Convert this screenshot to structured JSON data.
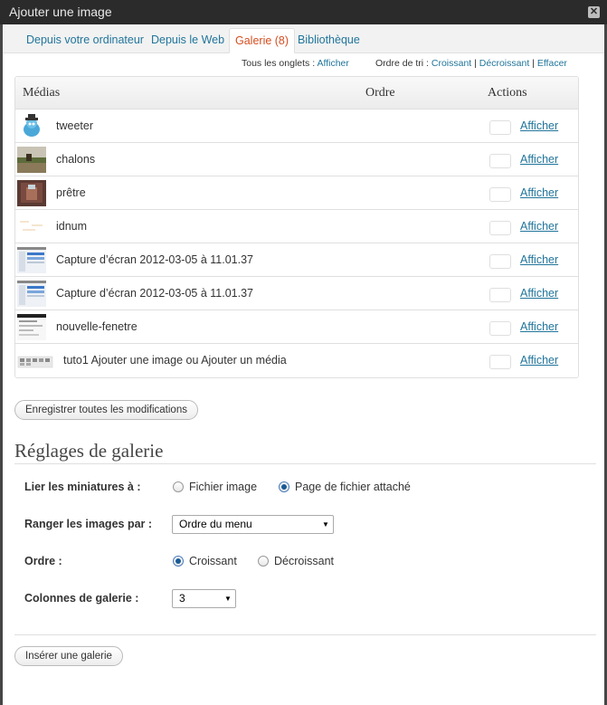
{
  "window": {
    "title": "Ajouter une image",
    "close_glyph": "✕"
  },
  "tabs": [
    {
      "label": "Depuis votre ordinateur",
      "active": false
    },
    {
      "label": "Depuis le Web",
      "active": false
    },
    {
      "label": "Galerie (8)",
      "active": true
    },
    {
      "label": "Bibliothèque",
      "active": false
    }
  ],
  "sort_bar": {
    "all_tabs_label": "Tous les onglets :",
    "all_tabs_link": "Afficher",
    "sort_label": "Ordre de tri :",
    "ascending": "Croissant",
    "separator": "|",
    "descending": "Décroissant",
    "clear": "Effacer"
  },
  "table": {
    "headers": {
      "media": "Médias",
      "order": "Ordre",
      "actions": "Actions"
    },
    "rows": [
      {
        "title": "tweeter",
        "action": "Afficher",
        "thumb": "bird-icon"
      },
      {
        "title": "chalons",
        "action": "Afficher",
        "thumb": "landscape-photo"
      },
      {
        "title": "prêtre",
        "action": "Afficher",
        "thumb": "portrait-photo"
      },
      {
        "title": "idnum",
        "action": "Afficher",
        "thumb": "light-graphic"
      },
      {
        "title": "Capture d’écran 2012-03-05 à 11.01.37",
        "action": "Afficher",
        "thumb": "screenshot"
      },
      {
        "title": "Capture d’écran 2012-03-05 à 11.01.37",
        "action": "Afficher",
        "thumb": "screenshot"
      },
      {
        "title": "nouvelle-fenetre",
        "action": "Afficher",
        "thumb": "window-screenshot"
      },
      {
        "title": "tuto1 Ajouter une image ou Ajouter un média",
        "action": "Afficher",
        "thumb": "toolbar-screenshot"
      }
    ]
  },
  "save_all_label": "Enregistrer toutes les modifications",
  "gallery_settings": {
    "title": "Réglages de galerie",
    "link_thumbs": {
      "label": "Lier les miniatures à :",
      "options": [
        "Fichier image",
        "Page de fichier attaché"
      ],
      "selected": 1
    },
    "order_by": {
      "label": "Ranger les images par :",
      "value": "Ordre du menu"
    },
    "order": {
      "label": "Ordre :",
      "options": [
        "Croissant",
        "Décroissant"
      ],
      "selected": 0
    },
    "columns": {
      "label": "Colonnes de galerie :",
      "value": "3"
    },
    "select_arrow": "▼"
  },
  "insert_gallery_label": "Insérer une galerie",
  "colors": {
    "link": "#21759b",
    "active_tab": "#d54e21",
    "titlebar": "#2b2b2b",
    "border": "#dfdfdf"
  }
}
